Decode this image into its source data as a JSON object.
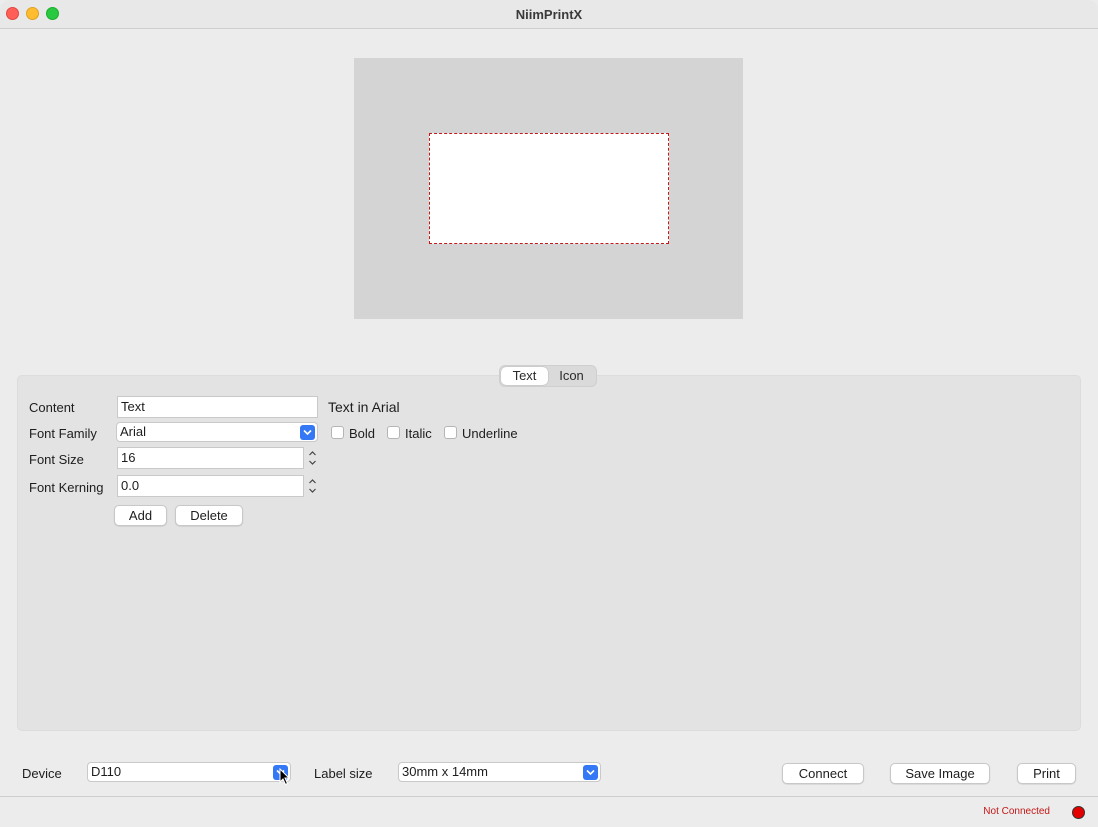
{
  "window": {
    "title": "NiimPrintX"
  },
  "tabs": [
    {
      "label": "Text",
      "active": true
    },
    {
      "label": "Icon",
      "active": false
    }
  ],
  "form": {
    "content_label": "Content",
    "content_value": "Text",
    "preview_text": "Text in Arial",
    "font_family_label": "Font Family",
    "font_family_value": "Arial",
    "bold_label": "Bold",
    "italic_label": "Italic",
    "underline_label": "Underline",
    "font_size_label": "Font Size",
    "font_size_value": "16",
    "font_kerning_label": "Font Kerning",
    "font_kerning_value": "0.0",
    "add_label": "Add",
    "delete_label": "Delete"
  },
  "footer": {
    "device_label": "Device",
    "device_value": "D110",
    "label_size_label": "Label size",
    "label_size_value": "30mm x 14mm",
    "connect_label": "Connect",
    "save_image_label": "Save Image",
    "print_label": "Print"
  },
  "status": {
    "text": "Not Connected",
    "text_color": "#c41818",
    "indicator_color": "#e50000"
  },
  "colors": {
    "accent": "#3478f6",
    "label_border": "#c41818"
  }
}
